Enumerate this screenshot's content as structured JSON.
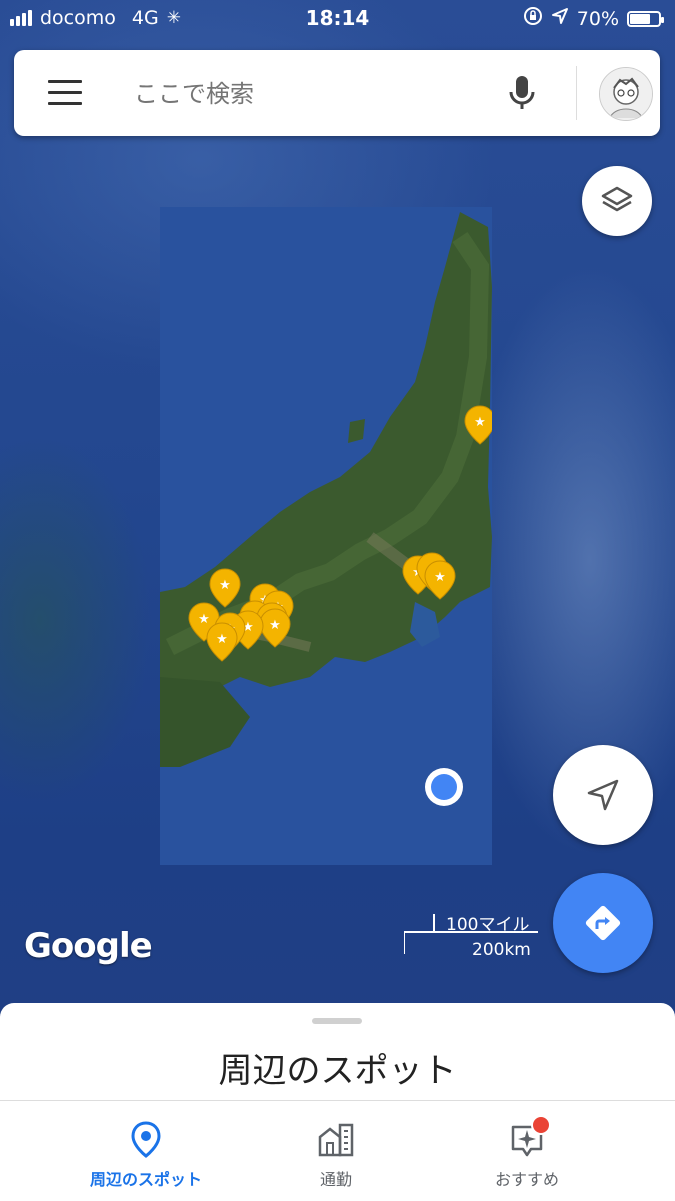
{
  "status_bar": {
    "carrier": "docomo",
    "network": "4G",
    "time": "18:14",
    "battery": "70%",
    "battery_level": 0.7
  },
  "search": {
    "placeholder": "ここで検索",
    "value": ""
  },
  "icons": {
    "menu": "hamburger-menu-icon",
    "mic": "microphone-icon",
    "layers": "layers-icon",
    "location": "navigation-arrow-icon",
    "directions": "directions-icon",
    "explore": "location-pin-icon",
    "commute": "commute-building-icon",
    "for_you": "sparkle-icon"
  },
  "map": {
    "brand": "Google",
    "scale_imperial": "100マイル",
    "scale_metric": "200km"
  },
  "sheet": {
    "title": "周辺のスポット"
  },
  "bottom_nav": {
    "items": [
      {
        "label": "周辺のスポット",
        "active": true
      },
      {
        "label": "通勤",
        "active": false
      },
      {
        "label": "おすすめ",
        "active": false,
        "badge": true
      }
    ]
  },
  "colors": {
    "accent_blue": "#1a73e8",
    "marker_yellow": "#f4b400",
    "location_dot": "#4285f4",
    "badge_red": "#ea4335"
  }
}
